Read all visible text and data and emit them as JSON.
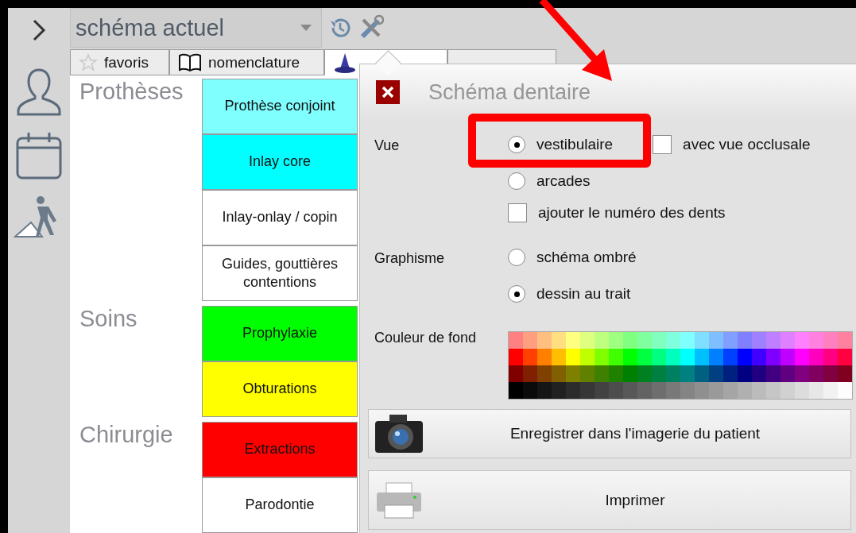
{
  "template_select": {
    "value": "schéma actuel"
  },
  "tabs": [
    {
      "kind": "star",
      "label": "favoris",
      "selected": false
    },
    {
      "kind": "book",
      "label": "nomenclature",
      "selected": false
    },
    {
      "kind": "hat",
      "selected": true
    },
    {
      "kind": "blank",
      "selected": false
    }
  ],
  "categories": [
    {
      "title": "Prothèses",
      "acts": [
        {
          "label": "Prothèse conjoint",
          "color": "#80ffff"
        },
        {
          "label": "Inlay core",
          "color": "#00ffff"
        },
        {
          "label": "Inlay-onlay / copin",
          "color": "#ffffff"
        },
        {
          "label": "Guides, gouttières\ncontentions",
          "color": "#ffffff"
        }
      ]
    },
    {
      "title": "Soins",
      "acts": [
        {
          "label": "Prophylaxie",
          "color": "#00ff00"
        },
        {
          "label": "Obturations",
          "color": "#ffff00"
        }
      ]
    },
    {
      "title": "Chirurgie",
      "acts": [
        {
          "label": "Extractions",
          "color": "#ff0000"
        },
        {
          "label": "Parodontie",
          "color": "#ffffff"
        }
      ]
    }
  ],
  "dialog": {
    "title": "Schéma dentaire",
    "sections": [
      {
        "label": "Vue",
        "rows": [
          [
            {
              "kind": "radio",
              "label": "vestibulaire",
              "selected": true
            },
            {
              "kind": "checkbox",
              "label": "avec vue occlusale",
              "checked": false
            }
          ],
          [
            {
              "kind": "radio",
              "label": "arcades",
              "selected": false
            }
          ],
          [
            {
              "kind": "checkbox",
              "label": "ajouter le numéro des dents",
              "checked": false
            }
          ]
        ]
      },
      {
        "label": "Graphisme",
        "rows": [
          [
            {
              "kind": "radio",
              "label": "schéma ombré",
              "selected": false
            }
          ],
          [
            {
              "kind": "radio",
              "label": "dessin au trait",
              "selected": true
            }
          ]
        ]
      }
    ],
    "background_color": {
      "label": "Couleur de fond"
    },
    "actions": [
      {
        "kind": "camera",
        "label": "Enregistrer dans l'imagerie du patient"
      },
      {
        "kind": "printer",
        "label": "Imprimer"
      }
    ]
  }
}
